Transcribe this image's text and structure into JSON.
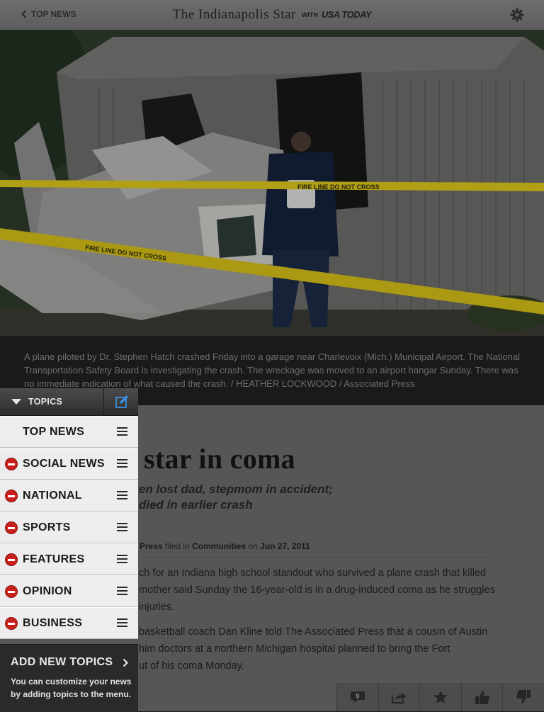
{
  "header": {
    "back_label": "TOP NEWS",
    "masthead_title": "The Indianapolis Star",
    "masthead_with": "WITH",
    "masthead_partner": "USA TODAY"
  },
  "photo": {
    "caption": "A plane piloted by Dr. Stephen Hatch crashed Friday into a garage near Charlevoix (Mich.) Municipal Airport. The National Transportation Safety Board is investigating the crash. The wreckage was moved to an airport hangar Sunday. There was no immediate indication of what caused the crash. / HEATHER LOCKWOOD / Associated Press",
    "tape_text": "FIRE LINE DO NOT CROSS"
  },
  "article": {
    "headline": "star in coma",
    "subhead_line1": "en lost dad, stepmom in accident;",
    "subhead_line2": "died in earlier crash",
    "byline_source": "Press",
    "byline_filed": "filed in",
    "byline_section": "Communities",
    "byline_on": "on",
    "byline_date": "Jun 27, 2011",
    "para1": [
      "ch for an Indiana high school standout who survived a plane crash that killed",
      "mother said Sunday the 16-year-old is in a drug-induced coma as he struggles",
      "injuries."
    ],
    "para2": [
      "basketball coach Dan Kline told The Associated Press that a cousin of Austin",
      "him doctors at a northern Michigan hospital planned to bring the Fort",
      "ut of his coma Monday."
    ]
  },
  "toolbar": {
    "comment_count": "9"
  },
  "topics_panel": {
    "header_label": "TOPICS",
    "items": [
      {
        "label": "TOP NEWS",
        "removable": false
      },
      {
        "label": "SOCIAL NEWS",
        "removable": true
      },
      {
        "label": "NATIONAL",
        "removable": true
      },
      {
        "label": "SPORTS",
        "removable": true
      },
      {
        "label": "FEATURES",
        "removable": true
      },
      {
        "label": "OPINION",
        "removable": true
      },
      {
        "label": "BUSINESS",
        "removable": true
      }
    ],
    "add_title": "ADD NEW TOPICS",
    "add_desc": "You can customize your news by adding topics to the menu."
  },
  "colors": {
    "remove_red": "#c8211c",
    "edit_blue": "#3d8fe0",
    "tape_yellow": "#d8c21c"
  }
}
